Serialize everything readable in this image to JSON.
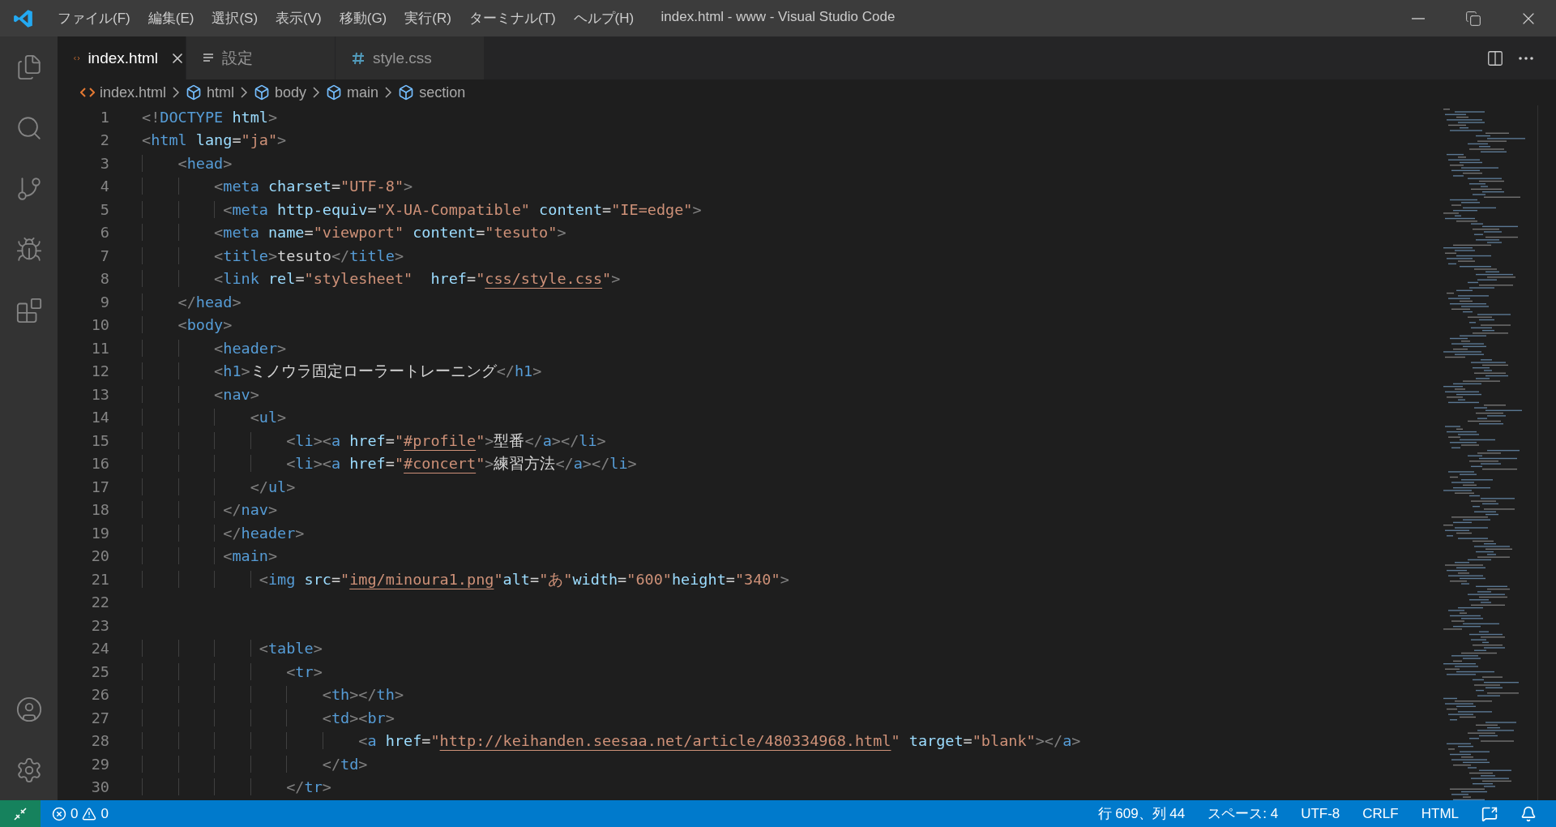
{
  "window": {
    "title": "index.html - www - Visual Studio Code"
  },
  "menu": [
    "ファイル(F)",
    "編集(E)",
    "選択(S)",
    "表示(V)",
    "移動(G)",
    "実行(R)",
    "ターミナル(T)",
    "ヘルプ(H)"
  ],
  "activity_bar": {
    "top": [
      {
        "kind": "explorer"
      },
      {
        "kind": "search"
      },
      {
        "kind": "source-control"
      },
      {
        "kind": "run"
      },
      {
        "kind": "extensions"
      }
    ],
    "bottom": [
      {
        "kind": "account"
      },
      {
        "kind": "settings"
      }
    ]
  },
  "tabs": [
    {
      "label": "index.html",
      "kind": "html",
      "selected": true
    },
    {
      "label": "設定",
      "kind": "settings",
      "selected": false
    },
    {
      "label": "style.css",
      "kind": "css",
      "selected": false
    }
  ],
  "breadcrumbs": [
    {
      "label": "index.html",
      "kind": "file"
    },
    {
      "label": "html",
      "kind": "element"
    },
    {
      "label": "body",
      "kind": "element"
    },
    {
      "label": "main",
      "kind": "element"
    },
    {
      "label": "section",
      "kind": "element"
    }
  ],
  "code_lines": [
    {
      "n": "1",
      "tokens": [
        {
          "kind": "punct",
          "text": "<!"
        },
        {
          "kind": "tag",
          "text": "DOCTYPE"
        },
        {
          "kind": "attr",
          "text": " html"
        },
        {
          "kind": "punct",
          "text": ">"
        }
      ]
    },
    {
      "n": "2",
      "tokens": [
        {
          "kind": "punct",
          "text": "<"
        },
        {
          "kind": "tag",
          "text": "html"
        },
        {
          "kind": "attr",
          "text": " lang"
        },
        {
          "kind": "text",
          "text": "="
        },
        {
          "kind": "str",
          "text": "\"ja\""
        },
        {
          "kind": "punct",
          "text": ">"
        }
      ]
    },
    {
      "n": "3",
      "tokens": [
        {
          "kind": "punct",
          "text": "    <"
        },
        {
          "kind": "tag",
          "text": "head"
        },
        {
          "kind": "punct",
          "text": ">"
        }
      ]
    },
    {
      "n": "4",
      "tokens": [
        {
          "kind": "punct",
          "text": "        <"
        },
        {
          "kind": "tag",
          "text": "meta"
        },
        {
          "kind": "attr",
          "text": " charset"
        },
        {
          "kind": "text",
          "text": "="
        },
        {
          "kind": "str",
          "text": "\"UTF-8\""
        },
        {
          "kind": "punct",
          "text": ">"
        }
      ]
    },
    {
      "n": "5",
      "tokens": [
        {
          "kind": "punct",
          "text": "         <"
        },
        {
          "kind": "tag",
          "text": "meta"
        },
        {
          "kind": "attr",
          "text": " http-equiv"
        },
        {
          "kind": "text",
          "text": "="
        },
        {
          "kind": "str",
          "text": "\"X-UA-Compatible\""
        },
        {
          "kind": "attr",
          "text": " content"
        },
        {
          "kind": "text",
          "text": "="
        },
        {
          "kind": "str",
          "text": "\"IE=edge\""
        },
        {
          "kind": "punct",
          "text": ">"
        }
      ]
    },
    {
      "n": "6",
      "tokens": [
        {
          "kind": "punct",
          "text": "        <"
        },
        {
          "kind": "tag",
          "text": "meta"
        },
        {
          "kind": "attr",
          "text": " name"
        },
        {
          "kind": "text",
          "text": "="
        },
        {
          "kind": "str",
          "text": "\"viewport\""
        },
        {
          "kind": "attr",
          "text": " content"
        },
        {
          "kind": "text",
          "text": "="
        },
        {
          "kind": "str",
          "text": "\"tesuto\""
        },
        {
          "kind": "punct",
          "text": ">"
        }
      ]
    },
    {
      "n": "7",
      "tokens": [
        {
          "kind": "punct",
          "text": "        <"
        },
        {
          "kind": "tag",
          "text": "title"
        },
        {
          "kind": "punct",
          "text": ">"
        },
        {
          "kind": "text",
          "text": "tesuto"
        },
        {
          "kind": "punct",
          "text": "</"
        },
        {
          "kind": "tag",
          "text": "title"
        },
        {
          "kind": "punct",
          "text": ">"
        }
      ]
    },
    {
      "n": "8",
      "tokens": [
        {
          "kind": "punct",
          "text": "        <"
        },
        {
          "kind": "tag",
          "text": "link"
        },
        {
          "kind": "attr",
          "text": " rel"
        },
        {
          "kind": "text",
          "text": "="
        },
        {
          "kind": "str",
          "text": "\"stylesheet\""
        },
        {
          "kind": "attr",
          "text": "  href"
        },
        {
          "kind": "text",
          "text": "="
        },
        {
          "kind": "str",
          "text": "\""
        },
        {
          "kind": "link",
          "text": "css/style.css"
        },
        {
          "kind": "str",
          "text": "\""
        },
        {
          "kind": "punct",
          "text": ">"
        }
      ]
    },
    {
      "n": "9",
      "tokens": [
        {
          "kind": "punct",
          "text": "    </"
        },
        {
          "kind": "tag",
          "text": "head"
        },
        {
          "kind": "punct",
          "text": ">"
        }
      ]
    },
    {
      "n": "10",
      "tokens": [
        {
          "kind": "punct",
          "text": "    <"
        },
        {
          "kind": "tag",
          "text": "body"
        },
        {
          "kind": "punct",
          "text": ">"
        }
      ]
    },
    {
      "n": "11",
      "tokens": [
        {
          "kind": "punct",
          "text": "        <"
        },
        {
          "kind": "tag",
          "text": "header"
        },
        {
          "kind": "punct",
          "text": ">"
        }
      ]
    },
    {
      "n": "12",
      "tokens": [
        {
          "kind": "punct",
          "text": "        <"
        },
        {
          "kind": "tag",
          "text": "h1"
        },
        {
          "kind": "punct",
          "text": ">"
        },
        {
          "kind": "text",
          "text": "ミノウラ固定ローラートレーニング"
        },
        {
          "kind": "punct",
          "text": "</"
        },
        {
          "kind": "tag",
          "text": "h1"
        },
        {
          "kind": "punct",
          "text": ">"
        }
      ]
    },
    {
      "n": "13",
      "tokens": [
        {
          "kind": "punct",
          "text": "        <"
        },
        {
          "kind": "tag",
          "text": "nav"
        },
        {
          "kind": "punct",
          "text": ">"
        }
      ]
    },
    {
      "n": "14",
      "tokens": [
        {
          "kind": "punct",
          "text": "            <"
        },
        {
          "kind": "tag",
          "text": "ul"
        },
        {
          "kind": "punct",
          "text": ">"
        }
      ]
    },
    {
      "n": "15",
      "tokens": [
        {
          "kind": "punct",
          "text": "                <"
        },
        {
          "kind": "tag",
          "text": "li"
        },
        {
          "kind": "punct",
          "text": "><"
        },
        {
          "kind": "tag",
          "text": "a"
        },
        {
          "kind": "attr",
          "text": " href"
        },
        {
          "kind": "text",
          "text": "="
        },
        {
          "kind": "str",
          "text": "\""
        },
        {
          "kind": "link",
          "text": "#profile"
        },
        {
          "kind": "str",
          "text": "\""
        },
        {
          "kind": "punct",
          "text": ">"
        },
        {
          "kind": "text",
          "text": "型番"
        },
        {
          "kind": "punct",
          "text": "</"
        },
        {
          "kind": "tag",
          "text": "a"
        },
        {
          "kind": "punct",
          "text": "></"
        },
        {
          "kind": "tag",
          "text": "li"
        },
        {
          "kind": "punct",
          "text": ">"
        }
      ]
    },
    {
      "n": "16",
      "tokens": [
        {
          "kind": "punct",
          "text": "                <"
        },
        {
          "kind": "tag",
          "text": "li"
        },
        {
          "kind": "punct",
          "text": "><"
        },
        {
          "kind": "tag",
          "text": "a"
        },
        {
          "kind": "attr",
          "text": " href"
        },
        {
          "kind": "text",
          "text": "="
        },
        {
          "kind": "str",
          "text": "\""
        },
        {
          "kind": "link",
          "text": "#concert"
        },
        {
          "kind": "str",
          "text": "\""
        },
        {
          "kind": "punct",
          "text": ">"
        },
        {
          "kind": "text",
          "text": "練習方法"
        },
        {
          "kind": "punct",
          "text": "</"
        },
        {
          "kind": "tag",
          "text": "a"
        },
        {
          "kind": "punct",
          "text": "></"
        },
        {
          "kind": "tag",
          "text": "li"
        },
        {
          "kind": "punct",
          "text": ">"
        }
      ]
    },
    {
      "n": "17",
      "tokens": [
        {
          "kind": "punct",
          "text": "            </"
        },
        {
          "kind": "tag",
          "text": "ul"
        },
        {
          "kind": "punct",
          "text": ">"
        }
      ]
    },
    {
      "n": "18",
      "tokens": [
        {
          "kind": "punct",
          "text": "         </"
        },
        {
          "kind": "tag",
          "text": "nav"
        },
        {
          "kind": "punct",
          "text": ">"
        }
      ]
    },
    {
      "n": "19",
      "tokens": [
        {
          "kind": "punct",
          "text": "         </"
        },
        {
          "kind": "tag",
          "text": "header"
        },
        {
          "kind": "punct",
          "text": ">"
        }
      ]
    },
    {
      "n": "20",
      "tokens": [
        {
          "kind": "punct",
          "text": "         <"
        },
        {
          "kind": "tag",
          "text": "main"
        },
        {
          "kind": "punct",
          "text": ">"
        }
      ]
    },
    {
      "n": "21",
      "tokens": [
        {
          "kind": "punct",
          "text": "             <"
        },
        {
          "kind": "tag",
          "text": "img"
        },
        {
          "kind": "attr",
          "text": " src"
        },
        {
          "kind": "text",
          "text": "="
        },
        {
          "kind": "str",
          "text": "\""
        },
        {
          "kind": "link",
          "text": "img/minoura1.png"
        },
        {
          "kind": "str",
          "text": "\""
        },
        {
          "kind": "attr",
          "text": "alt"
        },
        {
          "kind": "text",
          "text": "="
        },
        {
          "kind": "str",
          "text": "\"あ\""
        },
        {
          "kind": "attr",
          "text": "width"
        },
        {
          "kind": "text",
          "text": "="
        },
        {
          "kind": "str",
          "text": "\"600\""
        },
        {
          "kind": "attr",
          "text": "height"
        },
        {
          "kind": "text",
          "text": "="
        },
        {
          "kind": "str",
          "text": "\"340\""
        },
        {
          "kind": "punct",
          "text": ">"
        }
      ]
    },
    {
      "n": "22"
    },
    {
      "n": "23"
    },
    {
      "n": "24",
      "tokens": [
        {
          "kind": "punct",
          "text": "             <"
        },
        {
          "kind": "tag",
          "text": "table"
        },
        {
          "kind": "punct",
          "text": ">"
        }
      ]
    },
    {
      "n": "25",
      "tokens": [
        {
          "kind": "punct",
          "text": "                <"
        },
        {
          "kind": "tag",
          "text": "tr"
        },
        {
          "kind": "punct",
          "text": ">"
        }
      ]
    },
    {
      "n": "26",
      "tokens": [
        {
          "kind": "punct",
          "text": "                    <"
        },
        {
          "kind": "tag",
          "text": "th"
        },
        {
          "kind": "punct",
          "text": "></"
        },
        {
          "kind": "tag",
          "text": "th"
        },
        {
          "kind": "punct",
          "text": ">"
        }
      ]
    },
    {
      "n": "27",
      "tokens": [
        {
          "kind": "punct",
          "text": "                    <"
        },
        {
          "kind": "tag",
          "text": "td"
        },
        {
          "kind": "punct",
          "text": "><"
        },
        {
          "kind": "tag",
          "text": "br"
        },
        {
          "kind": "punct",
          "text": ">"
        }
      ]
    },
    {
      "n": "28",
      "tokens": [
        {
          "kind": "punct",
          "text": "                        <"
        },
        {
          "kind": "tag",
          "text": "a"
        },
        {
          "kind": "attr",
          "text": " href"
        },
        {
          "kind": "text",
          "text": "="
        },
        {
          "kind": "str",
          "text": "\""
        },
        {
          "kind": "link",
          "text": "http://keihanden.seesaa.net/article/480334968.html"
        },
        {
          "kind": "str",
          "text": "\""
        },
        {
          "kind": "attr",
          "text": " target"
        },
        {
          "kind": "text",
          "text": "="
        },
        {
          "kind": "str",
          "text": "\"blank\""
        },
        {
          "kind": "punct",
          "text": "></"
        },
        {
          "kind": "tag",
          "text": "a"
        },
        {
          "kind": "punct",
          "text": ">"
        }
      ]
    },
    {
      "n": "29",
      "tokens": [
        {
          "kind": "punct",
          "text": "                    </"
        },
        {
          "kind": "tag",
          "text": "td"
        },
        {
          "kind": "punct",
          "text": ">"
        }
      ]
    },
    {
      "n": "30",
      "tokens": [
        {
          "kind": "punct",
          "text": "                </"
        },
        {
          "kind": "tag",
          "text": "tr"
        },
        {
          "kind": "punct",
          "text": ">"
        }
      ]
    }
  ],
  "status_bar": {
    "errors": "0",
    "warnings": "0",
    "items": [
      "行 609、列 44",
      "スペース: 4",
      "UTF-8",
      "CRLF",
      "HTML"
    ]
  }
}
